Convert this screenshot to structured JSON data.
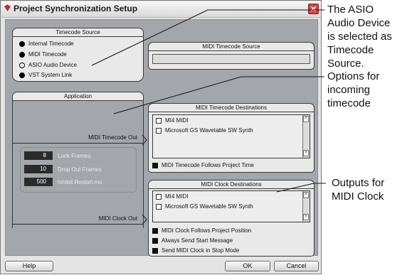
{
  "window": {
    "title": "Project Synchronization Setup"
  },
  "timecode_source": {
    "title": "Timecode Source",
    "options": [
      {
        "label": "Internal Timecode",
        "selected": false
      },
      {
        "label": "MIDI Timecode",
        "selected": false
      },
      {
        "label": "ASIO Audio Device",
        "selected": true
      },
      {
        "label": "VST System Link",
        "selected": false
      }
    ]
  },
  "midi_timecode_source": {
    "title": "MIDI Timecode Source"
  },
  "application": {
    "title": "Application",
    "midi_timecode_out_label": "MIDI Timecode Out",
    "midi_clock_out_label": "MIDI Clock Out",
    "fields": [
      {
        "value": "8",
        "label": "Lock Frames"
      },
      {
        "value": "10",
        "label": "Drop Out Frames"
      },
      {
        "value": "500",
        "label": "Inhibit Restart ms"
      }
    ]
  },
  "midi_timecode_destinations": {
    "title": "MIDI Timecode Destinations",
    "items": [
      "MI4 MIDI",
      "Microsoft GS Wavetable SW Synth"
    ],
    "follows_label": "MIDI Timecode Follows Project Time"
  },
  "midi_clock_destinations": {
    "title": "MIDI Clock Destinations",
    "items": [
      "MI4 MIDI",
      "Microsoft GS Wavetable SW Synth"
    ],
    "options": [
      "MIDI Clock Follows Project Position",
      "Always Send Start Message",
      "Send MIDI Clock in Stop Mode"
    ]
  },
  "buttons": {
    "help": "Help",
    "ok": "OK",
    "cancel": "Cancel"
  },
  "annotations": {
    "asio_lines": [
      "The ASIO",
      "Audio Device",
      "is selected as",
      "Timecode",
      "Source."
    ],
    "incoming_lines": [
      "Options for",
      "incoming",
      "timecode"
    ],
    "clock_lines": [
      "Outputs for",
      "MIDI Clock"
    ]
  },
  "colors": {
    "window_bg": "#e4e4e4",
    "inner_bg": "#a3a6aa",
    "close_button": "#d8413a",
    "logo_red": "#c0282d"
  },
  "icons": {
    "logo": "cubase-logo-icon",
    "close": "close-icon"
  }
}
